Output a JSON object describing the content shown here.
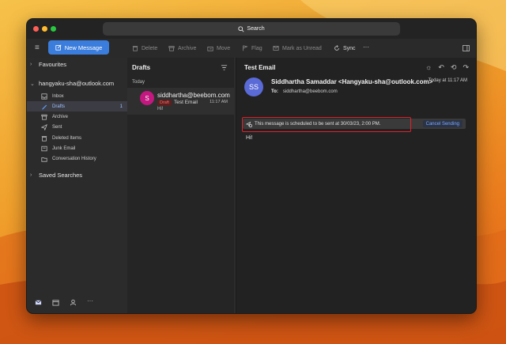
{
  "window": {
    "search_label": "Search"
  },
  "toolbar": {
    "new_message": "New Message",
    "delete": "Delete",
    "archive": "Archive",
    "move": "Move",
    "flag": "Flag",
    "mark_unread": "Mark as Unread",
    "sync": "Sync",
    "more": "···"
  },
  "sidebar": {
    "favourites": "Favourites",
    "account": "hangyaku-sha@outlook.com",
    "folders": [
      {
        "label": "Inbox",
        "icon": "inbox-icon",
        "count": ""
      },
      {
        "label": "Drafts",
        "icon": "pencil-icon",
        "count": "1"
      },
      {
        "label": "Archive",
        "icon": "archive-icon",
        "count": ""
      },
      {
        "label": "Sent",
        "icon": "send-icon",
        "count": ""
      },
      {
        "label": "Deleted Items",
        "icon": "trash-icon",
        "count": ""
      },
      {
        "label": "Junk Email",
        "icon": "junk-icon",
        "count": ""
      },
      {
        "label": "Conversation History",
        "icon": "folder-icon",
        "count": ""
      }
    ],
    "saved_searches": "Saved Searches"
  },
  "list": {
    "header": "Drafts",
    "group": "Today",
    "items": [
      {
        "avatar": "S",
        "from": "siddhartha@beebom.com",
        "badge": "Draft",
        "subject": "Test Email",
        "time": "11:17 AM",
        "preview": "Hi!"
      }
    ]
  },
  "reading": {
    "subject": "Test Email",
    "avatar": "SS",
    "sender": "Siddhartha Samaddar <Hangyaku-sha@outlook.com>",
    "to_label": "To:",
    "to": "siddhartha@beebom.com",
    "time": "Today at 11:17 AM",
    "schedule_notice": "This message is scheduled to be sent at 30/03/23, 2:00 PM.",
    "cancel_label": "Cancel Sending",
    "body": "Hi!"
  },
  "colors": {
    "accent": "#3b7ddd",
    "avatar_s": "#c2187f",
    "avatar_ss": "#5a6ad6",
    "highlight": "#e0202a",
    "draft": "#ff6c6c"
  }
}
